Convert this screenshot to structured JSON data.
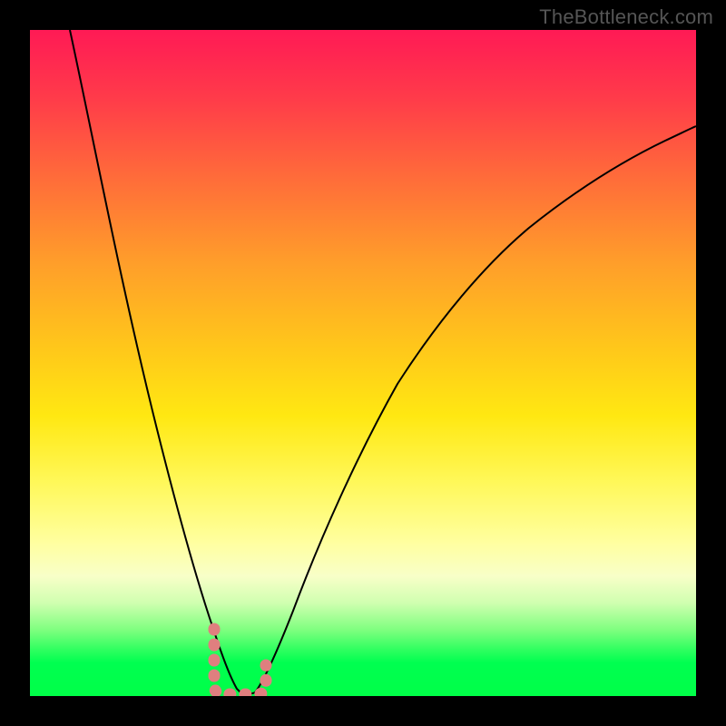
{
  "watermark": "TheBottleneck.com",
  "chart_data": {
    "type": "line",
    "title": "",
    "xlabel": "",
    "ylabel": "",
    "xlim": [
      0,
      100
    ],
    "ylim": [
      0,
      100
    ],
    "background_gradient": {
      "top": "#ff1a55",
      "bottom": "#00ff48",
      "stops": [
        "red",
        "orange",
        "yellow",
        "light-yellow",
        "green"
      ]
    },
    "series": [
      {
        "name": "bottleneck-curve",
        "type": "line",
        "color": "#000000",
        "x": [
          6,
          10,
          15,
          20,
          23,
          26,
          28,
          30,
          31.5,
          33,
          35,
          40,
          45,
          50,
          55,
          60,
          65,
          70,
          75,
          80,
          85,
          90,
          95,
          100
        ],
        "y": [
          100,
          80,
          58,
          36,
          23,
          11,
          4,
          0,
          0,
          0,
          3,
          14,
          25,
          34,
          42,
          49,
          55,
          60,
          64,
          68,
          71,
          74,
          76.5,
          79
        ]
      },
      {
        "name": "highlight-marker",
        "type": "marker",
        "color": "#e08080",
        "shape": "rounded-rect-path",
        "x_range": [
          27.5,
          34.5
        ],
        "y_range": [
          0,
          10
        ]
      }
    ]
  }
}
